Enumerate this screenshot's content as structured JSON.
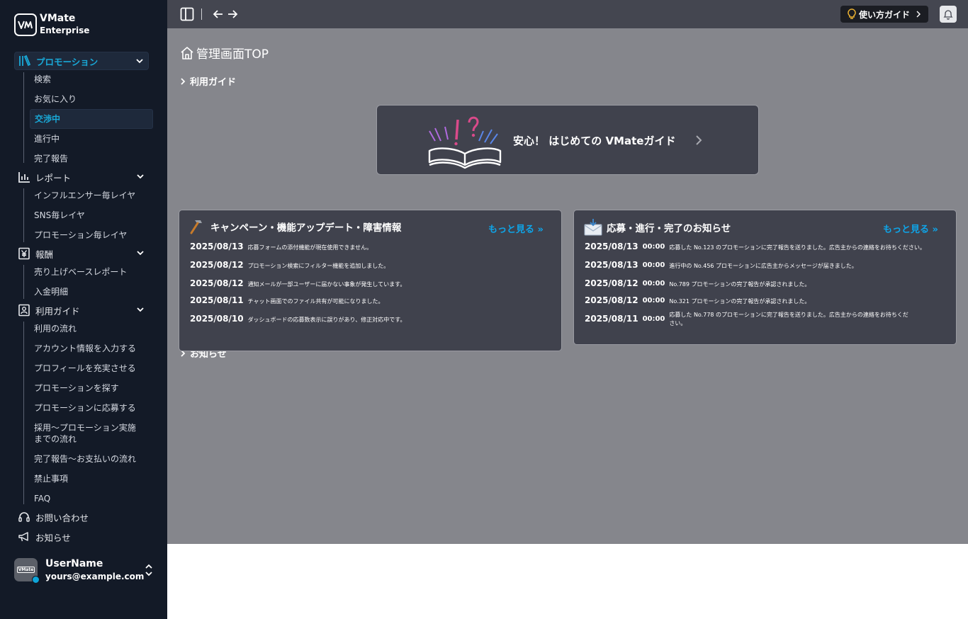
{
  "app": {
    "name": "VMate",
    "edition": "Enterprise",
    "logo_text": "VM"
  },
  "sidebar": {
    "sections": [
      {
        "label": "プロモーション",
        "icon": "books-icon",
        "items": [
          "検索",
          "お気に入り",
          "交渉中",
          "進行中",
          "完了報告"
        ],
        "active_item": "交渉中"
      },
      {
        "label": "レポート",
        "icon": "bar-chart-icon",
        "items": [
          "インフルエンサー毎レイヤ",
          "SNS毎レイヤ",
          "プロモーション毎レイヤ"
        ]
      },
      {
        "label": "報酬",
        "icon": "yen-icon",
        "items": [
          "売り上げベースレポート",
          "入金明細"
        ]
      },
      {
        "label": "利用ガイド",
        "icon": "guide-icon",
        "items": [
          "利用の流れ",
          "アカウント情報を入力する",
          "プロフィールを充実させる",
          "プロモーションを探す",
          "プロモーションに応募する",
          "採用〜プロモーション実施\nまでの流れ",
          "完了報告〜お支払いの流れ",
          "禁止事項",
          "FAQ"
        ]
      }
    ],
    "links": [
      {
        "label": "お問い合わせ",
        "icon": "headset-icon"
      },
      {
        "label": "お知らせ",
        "icon": "megaphone-icon"
      }
    ],
    "user": {
      "name": "UserName",
      "email": "yours@example.com",
      "avatar_text": "VMate"
    }
  },
  "topbar": {
    "guide_label": "使い方ガイド"
  },
  "main": {
    "title": "管理画面TOP",
    "guide_toggle": "利用ガイド",
    "news_toggle": "お知らせ",
    "banner_label": "安心！ はじめての VMateガイド",
    "campaign": {
      "title": "キャンペーン・機能アップデート・障害情報",
      "more": "もっと見る »",
      "rows": [
        {
          "date": "2025/08/13",
          "msg": "応募フォームの添付機能が現在使用できません。"
        },
        {
          "date": "2025/08/12",
          "msg": "プロモーション検索にフィルター機能を追加しました。"
        },
        {
          "date": "2025/08/12",
          "msg": "通知メールが一部ユーザーに届かない事象が発生しています。"
        },
        {
          "date": "2025/08/11",
          "msg": "チャット画面でのファイル共有が可能になりました。"
        },
        {
          "date": "2025/08/10",
          "msg": "ダッシュボードの応募数表示に誤りがあり、修正対応中です。"
        }
      ]
    },
    "notice": {
      "title": "応募・進行・完了のお知らせ",
      "more": "もっと見る »",
      "rows": [
        {
          "date": "2025/08/13",
          "time": "00:00",
          "msg": "応募した No.123 のプロモーションに完了報告を送りました。広告主からの連絡をお待ちください。"
        },
        {
          "date": "2025/08/13",
          "time": "00:00",
          "msg": "進行中の No.456 プロモーションに広告主からメッセージが届きました。"
        },
        {
          "date": "2025/08/12",
          "time": "00:00",
          "msg": "No.789 プロモーションの完了報告が承認されました。"
        },
        {
          "date": "2025/08/12",
          "time": "00:00",
          "msg": "No.321 プロモーションの完了報告が承認されました。"
        },
        {
          "date": "2025/08/11",
          "time": "00:00",
          "msg": "応募した No.778 のプロモーションに完了報告を送りました。広告主からの連絡をお待ちください。"
        }
      ]
    }
  },
  "colors": {
    "accent": "#19a9d8",
    "link": "#0ea5e9",
    "sidebar_bg": "#131a27",
    "main_bg": "#85868c",
    "card_bg": "#40424d"
  }
}
